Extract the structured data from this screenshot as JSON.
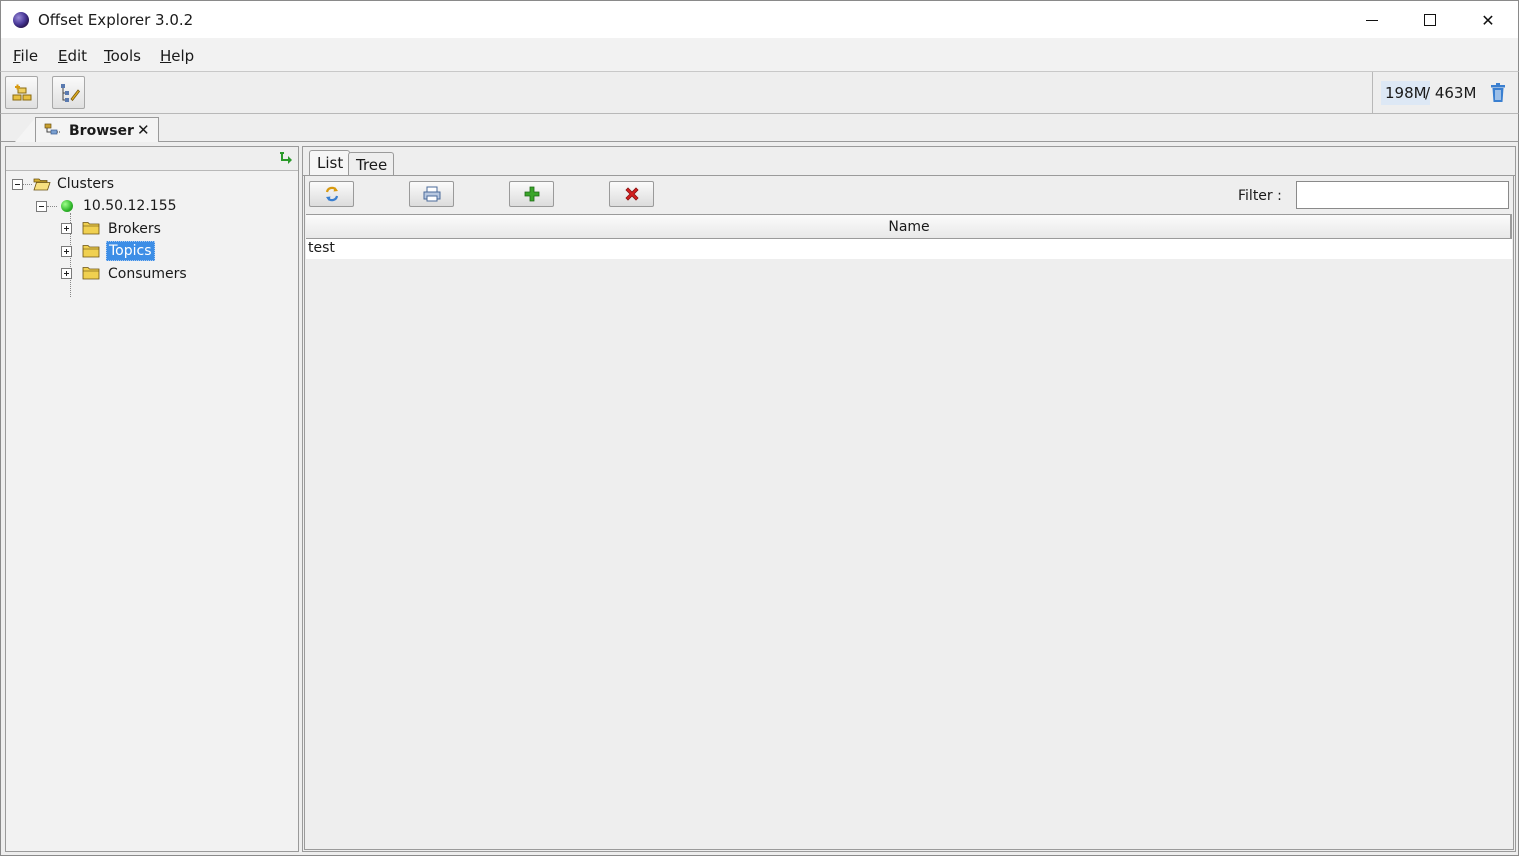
{
  "window": {
    "title": "Offset Explorer  3.0.2",
    "minimize_icon": "minimize-icon",
    "maximize_icon": "maximize-icon",
    "close_glyph": "✕"
  },
  "menu": {
    "items": [
      {
        "mnemonic": "F",
        "rest": "ile"
      },
      {
        "mnemonic": "E",
        "rest": "dit"
      },
      {
        "mnemonic": "T",
        "rest": "ools"
      },
      {
        "mnemonic": "H",
        "rest": "elp"
      }
    ]
  },
  "toolbar": {
    "memory_used": "198M",
    "memory_total": " / 463M",
    "icons": [
      "add-cluster-icon",
      "tree-edit-icon",
      "trash-icon"
    ]
  },
  "doc_tab": {
    "label": "Browser",
    "close": "✕"
  },
  "tree": {
    "root": "Clusters",
    "cluster": "10.50.12.155",
    "children": [
      "Brokers",
      "Topics",
      "Consumers"
    ],
    "selected": "Topics"
  },
  "sub_tabs": [
    "List",
    "Tree"
  ],
  "filter": {
    "label": "Filter :",
    "value": ""
  },
  "table": {
    "column": "Name",
    "rows": [
      "test"
    ]
  },
  "colors": {
    "selection": "#3d8ee6",
    "status_connected": "#2fb52a",
    "delete_red": "#d42020",
    "add_green": "#3aa52a"
  }
}
